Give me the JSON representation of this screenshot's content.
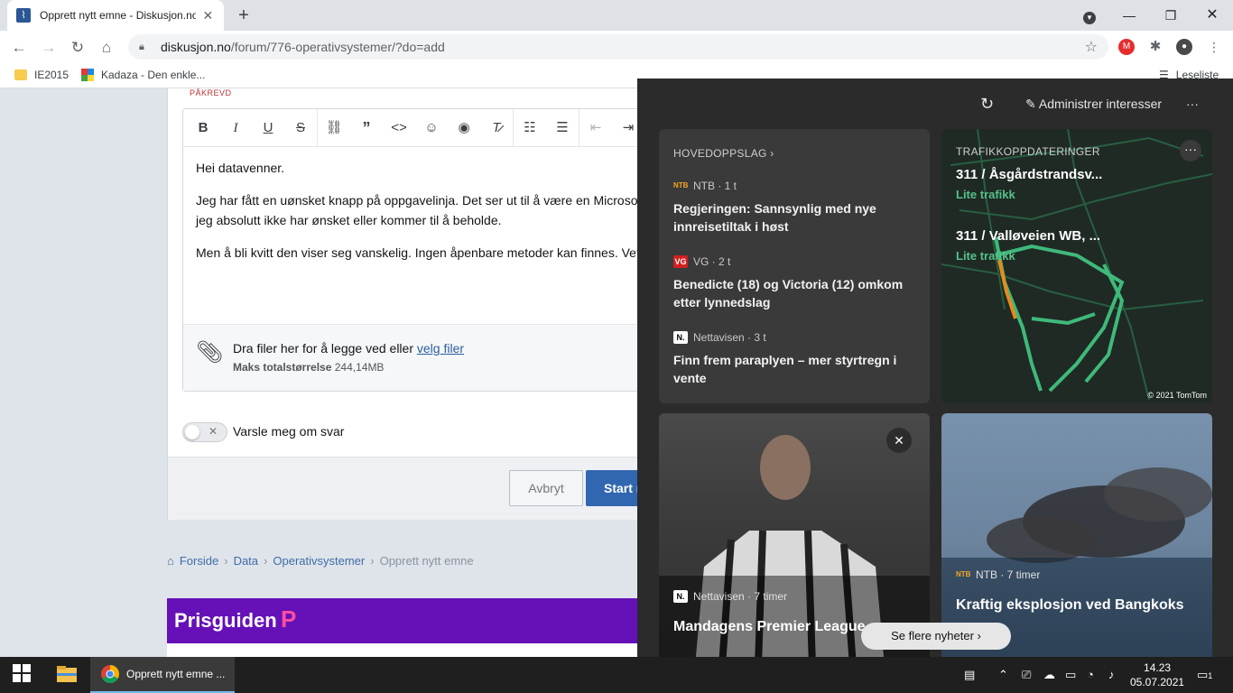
{
  "browser": {
    "tab_title": "Opprett nytt emne - Diskusjon.no",
    "url_host": "diskusjon.no",
    "url_path": "/forum/776-operativsystemer/?do=add",
    "bookmarks": [
      "IE2015",
      "Kadaza - Den enkle..."
    ],
    "reading_list": "Leseliste"
  },
  "editor": {
    "required_label": "PÅKREVD",
    "paragraphs": [
      "Hei datavenner.",
      "Jeg har fått en uønsket knapp på oppgavelinja. Det ser ut til å være en Microsof",
      "jeg absolutt ikke har ønsket eller kommer til å beholde.",
      "Men å bli kvitt den viser seg vanskelig. Ingen åpenbare metoder kan finnes. Vet"
    ],
    "attach_text": "Dra filer her for å legge ved eller",
    "attach_link": "velg filer",
    "max_size_label": "Maks totalstørrelse",
    "max_size_value": "244,14MB"
  },
  "form": {
    "notify_label": "Varsle meg om svar",
    "cancel_label": "Avbryt",
    "start_label": "Start n"
  },
  "breadcrumb": {
    "items": [
      "Forside",
      "Data",
      "Operativsystemer"
    ],
    "current": "Opprett nytt emne"
  },
  "ad": {
    "brand": "Prisguiden",
    "logo": "P"
  },
  "news": {
    "manage_label": "Administrer interesser",
    "top_stories_label": "HOVEDOPPSLAG",
    "stories": [
      {
        "source": "NTB · 1 t",
        "logo": "NTB",
        "title": "Regjeringen: Sannsynlig med nye innreisetiltak i høst"
      },
      {
        "source": "VG · 2 t",
        "logo": "VG",
        "title": "Benedicte (18) og Victoria (12) omkom etter lynnedslag"
      },
      {
        "source": "Nettavisen · 3 t",
        "logo": "N.",
        "title": "Finn frem paraplyen – mer styrtregn i vente"
      }
    ],
    "traffic": {
      "label": "TRAFIKKOPPDATERINGER",
      "routes": [
        {
          "name": "311 / Åsgårdstrandsv...",
          "status": "Lite trafikk"
        },
        {
          "name": "311 / Valløveien WB, ...",
          "status": "Lite trafikk"
        }
      ],
      "credit": "© 2021 TomTom"
    },
    "photo_cards": [
      {
        "source": "Nettavisen · 7 timer",
        "logo": "N.",
        "title": "Mandagens Premier League-s"
      },
      {
        "source": "NTB · 7 timer",
        "logo": "NTB",
        "title": "Kraftig eksplosjon ved Bangkoks"
      }
    ],
    "see_more": "Se flere nyheter"
  },
  "taskbar": {
    "app_label": "Opprett nytt emne ...",
    "time": "14.23",
    "date": "05.07.2021",
    "notifications": "1"
  }
}
